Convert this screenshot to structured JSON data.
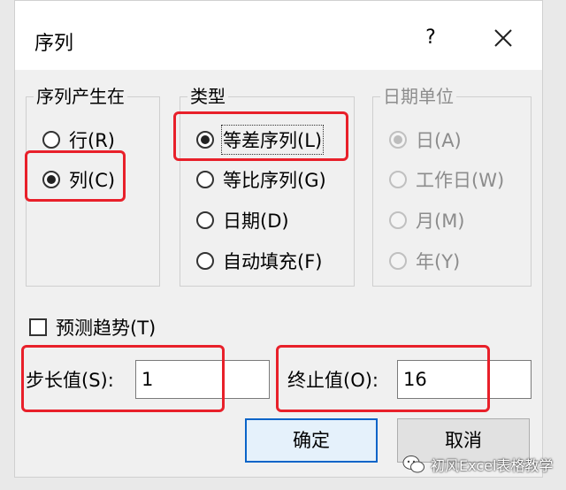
{
  "dialog": {
    "title": "序列",
    "help_label": "?",
    "close_icon": "close-icon"
  },
  "series_in": {
    "title": "序列产生在",
    "options": [
      {
        "label": "行(R)",
        "checked": false
      },
      {
        "label": "列(C)",
        "checked": true
      }
    ]
  },
  "type": {
    "title": "类型",
    "options": [
      {
        "label": "等差序列(L)",
        "checked": true
      },
      {
        "label": "等比序列(G)",
        "checked": false
      },
      {
        "label": "日期(D)",
        "checked": false
      },
      {
        "label": "自动填充(F)",
        "checked": false
      }
    ]
  },
  "date_unit": {
    "title": "日期单位",
    "disabled": true,
    "options": [
      {
        "label": "日(A)",
        "checked": true
      },
      {
        "label": "工作日(W)",
        "checked": false
      },
      {
        "label": "月(M)",
        "checked": false
      },
      {
        "label": "年(Y)",
        "checked": false
      }
    ]
  },
  "trend": {
    "label": "预测趋势(T)",
    "checked": false
  },
  "step": {
    "label": "步长值(S):",
    "value": "1"
  },
  "stop": {
    "label": "终止值(O):",
    "value": "16"
  },
  "buttons": {
    "ok": "确定",
    "cancel": "取消"
  },
  "watermark": {
    "text": "初风Excel表格教学"
  },
  "colors": {
    "highlight": "#e8202a",
    "default_button_border": "#0a64c8"
  }
}
